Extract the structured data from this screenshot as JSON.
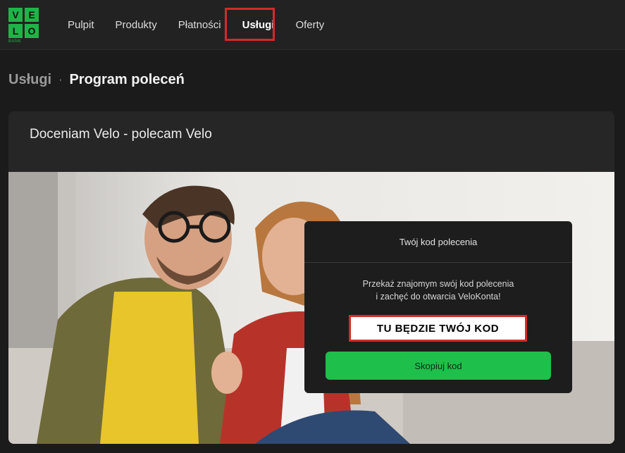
{
  "brand": {
    "letters": [
      "V",
      "E",
      "L",
      "O"
    ],
    "sub": "BANK",
    "color": "#1fb44a"
  },
  "nav": {
    "items": [
      {
        "label": "Pulpit"
      },
      {
        "label": "Produkty"
      },
      {
        "label": "Płatności"
      },
      {
        "label": "Usługi",
        "active": true
      },
      {
        "label": "Oferty"
      }
    ]
  },
  "breadcrumb": {
    "parent": "Usługi",
    "separator": "·",
    "current": "Program poleceń"
  },
  "card": {
    "title": "Doceniam Velo - polecam Velo"
  },
  "referral": {
    "title": "Twój kod polecenia",
    "desc_line1": "Przekaż znajomym swój kod polecenia",
    "desc_line2": "i zachęć do otwarcia VeloKonta!",
    "code": "TU BĘDZIE TWÓJ KOD",
    "button": "Skopiuj kod"
  },
  "colors": {
    "accent": "#1fbf4b",
    "highlight": "#d42a2a"
  }
}
